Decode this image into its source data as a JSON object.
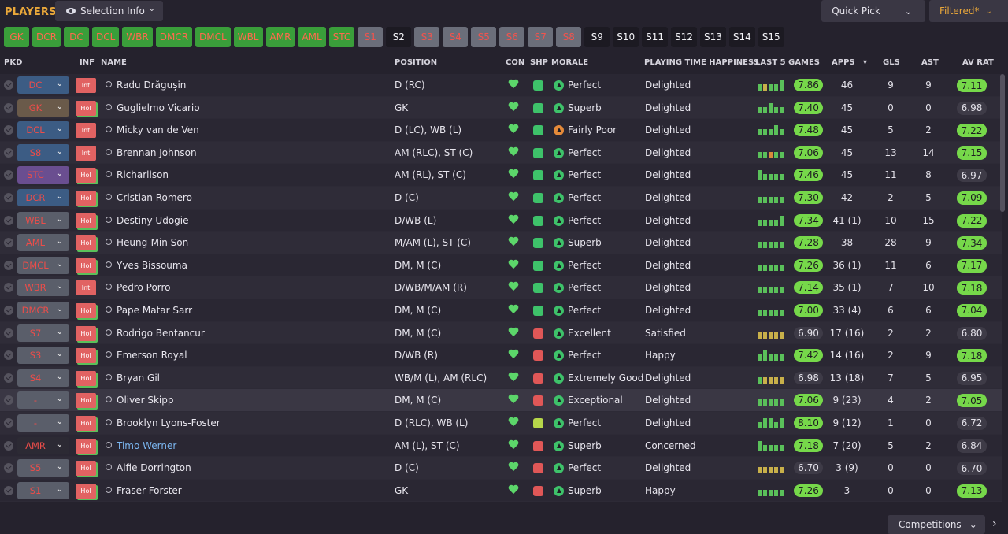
{
  "header": {
    "title": "PLAYERS",
    "selection_info": "Selection Info",
    "quick_pick": "Quick Pick",
    "filtered": "Filtered*",
    "competitions": "Competitions"
  },
  "chips": [
    {
      "label": "GK",
      "style": "green"
    },
    {
      "label": "DCR",
      "style": "green"
    },
    {
      "label": "DC",
      "style": "green"
    },
    {
      "label": "DCL",
      "style": "green"
    },
    {
      "label": "WBR",
      "style": "green"
    },
    {
      "label": "DMCR",
      "style": "green"
    },
    {
      "label": "DMCL",
      "style": "green"
    },
    {
      "label": "WBL",
      "style": "green"
    },
    {
      "label": "AMR",
      "style": "green"
    },
    {
      "label": "AML",
      "style": "green"
    },
    {
      "label": "STC",
      "style": "green"
    },
    {
      "label": "S1",
      "style": "grey"
    },
    {
      "label": "S2",
      "style": "black"
    },
    {
      "label": "S3",
      "style": "grey"
    },
    {
      "label": "S4",
      "style": "grey"
    },
    {
      "label": "S5",
      "style": "grey"
    },
    {
      "label": "S6",
      "style": "grey"
    },
    {
      "label": "S7",
      "style": "grey"
    },
    {
      "label": "S8",
      "style": "grey"
    },
    {
      "label": "S9",
      "style": "black"
    },
    {
      "label": "S10",
      "style": "black"
    },
    {
      "label": "S11",
      "style": "black"
    },
    {
      "label": "S12",
      "style": "black"
    },
    {
      "label": "S13",
      "style": "black"
    },
    {
      "label": "S14",
      "style": "black"
    },
    {
      "label": "S15",
      "style": "black"
    }
  ],
  "columns": {
    "pkd": "PKD",
    "inf": "INF",
    "name": "NAME",
    "position": "POSITION",
    "con": "CON",
    "shp": "SHP",
    "morale": "MORALE",
    "pth": "PLAYING TIME HAPPINESS",
    "last5": "LAST 5 GAMES",
    "apps": "APPS",
    "gls": "GLS",
    "ast": "AST",
    "avrat": "AV RAT"
  },
  "colors": {
    "accent": "#e9a73a",
    "tag_blue": "#3c5c84",
    "tag_brown": "#6a5a4a",
    "tag_purple": "#6a4e90",
    "tag_grey": "#5a5e6a",
    "tag_dark": "#2c2a34",
    "morale_green": "#3ec26a",
    "morale_orange": "#e58a3a",
    "rating_green": "#76d84a"
  },
  "players": [
    {
      "pos": "DC",
      "tag": "tag_blue",
      "inf": "Int",
      "name": "Radu Drăgușin",
      "position": "D (RC)",
      "ship": "good",
      "morale": "Perfect",
      "morale_color": "morale_green",
      "pth": "Delighted",
      "form": [
        "g",
        "y",
        "g",
        "g",
        "t"
      ],
      "l5": "7.86",
      "l5hi": true,
      "apps": "46",
      "gls": "9",
      "ast": "9",
      "avr": "7.11",
      "avrhi": true
    },
    {
      "pos": "GK",
      "tag": "tag_brown",
      "inf": "Hol",
      "name": "Guglielmo Vicario",
      "position": "GK",
      "ship": "good",
      "morale": "Superb",
      "morale_color": "morale_green",
      "pth": "Delighted",
      "form": [
        "g",
        "g",
        "t",
        "g",
        "g"
      ],
      "l5": "7.40",
      "l5hi": true,
      "apps": "45",
      "gls": "0",
      "ast": "0",
      "avr": "6.98",
      "avrhi": false
    },
    {
      "pos": "DCL",
      "tag": "tag_blue",
      "inf": "Int",
      "name": "Micky van de Ven",
      "position": "D (LC), WB (L)",
      "ship": "good",
      "morale": "Fairly Poor",
      "morale_color": "morale_orange",
      "pth": "Delighted",
      "form": [
        "g",
        "g",
        "g",
        "t",
        "g"
      ],
      "l5": "7.48",
      "l5hi": true,
      "apps": "45",
      "gls": "5",
      "ast": "2",
      "avr": "7.22",
      "avrhi": true
    },
    {
      "pos": "S8",
      "tag": "tag_blue",
      "inf": "Int",
      "name": "Brennan Johnson",
      "position": "AM (RLC), ST (C)",
      "ship": "good",
      "morale": "Perfect",
      "morale_color": "morale_green",
      "pth": "Delighted",
      "form": [
        "g",
        "g",
        "o",
        "g",
        "g"
      ],
      "l5": "7.06",
      "l5hi": true,
      "apps": "45",
      "gls": "13",
      "ast": "14",
      "avr": "7.15",
      "avrhi": true
    },
    {
      "pos": "STC",
      "tag": "tag_purple",
      "inf": "Hol",
      "name": "Richarlison",
      "position": "AM (RL), ST (C)",
      "ship": "good",
      "morale": "Perfect",
      "morale_color": "morale_green",
      "pth": "Delighted",
      "form": [
        "t",
        "g",
        "g",
        "g",
        "g"
      ],
      "l5": "7.46",
      "l5hi": true,
      "apps": "45",
      "gls": "11",
      "ast": "8",
      "avr": "6.97",
      "avrhi": false
    },
    {
      "pos": "DCR",
      "tag": "tag_blue",
      "inf": "Hol",
      "name": "Cristian Romero",
      "position": "D (C)",
      "ship": "good",
      "morale": "Perfect",
      "morale_color": "morale_green",
      "pth": "Delighted",
      "form": [
        "g",
        "g",
        "g",
        "g",
        "g"
      ],
      "l5": "7.30",
      "l5hi": true,
      "apps": "42",
      "gls": "2",
      "ast": "5",
      "avr": "7.09",
      "avrhi": true
    },
    {
      "pos": "WBL",
      "tag": "tag_grey",
      "inf": "Hol",
      "name": "Destiny Udogie",
      "position": "D/WB (L)",
      "ship": "good",
      "morale": "Perfect",
      "morale_color": "morale_green",
      "pth": "Delighted",
      "form": [
        "g",
        "g",
        "g",
        "g",
        "t"
      ],
      "l5": "7.34",
      "l5hi": true,
      "apps": "41 (1)",
      "gls": "10",
      "ast": "15",
      "avr": "7.22",
      "avrhi": true
    },
    {
      "pos": "AML",
      "tag": "tag_grey",
      "inf": "Hol",
      "name": "Heung-Min Son",
      "position": "M/AM (L), ST (C)",
      "ship": "good",
      "morale": "Superb",
      "morale_color": "morale_green",
      "pth": "Delighted",
      "form": [
        "g",
        "g",
        "g",
        "g",
        "g"
      ],
      "l5": "7.28",
      "l5hi": true,
      "apps": "38",
      "gls": "28",
      "ast": "9",
      "avr": "7.34",
      "avrhi": true
    },
    {
      "pos": "DMCL",
      "tag": "tag_grey",
      "inf": "Hol",
      "name": "Yves Bissouma",
      "position": "DM, M (C)",
      "ship": "good",
      "morale": "Perfect",
      "morale_color": "morale_green",
      "pth": "Delighted",
      "form": [
        "g",
        "g",
        "g",
        "g",
        "g"
      ],
      "l5": "7.26",
      "l5hi": true,
      "apps": "36 (1)",
      "gls": "11",
      "ast": "6",
      "avr": "7.17",
      "avrhi": true
    },
    {
      "pos": "WBR",
      "tag": "tag_grey",
      "inf": "Int",
      "name": "Pedro Porro",
      "position": "D/WB/M/AM (R)",
      "ship": "good",
      "morale": "Perfect",
      "morale_color": "morale_green",
      "pth": "Delighted",
      "form": [
        "g",
        "g",
        "g",
        "g",
        "g"
      ],
      "l5": "7.14",
      "l5hi": true,
      "apps": "35 (1)",
      "gls": "7",
      "ast": "10",
      "avr": "7.18",
      "avrhi": true
    },
    {
      "pos": "DMCR",
      "tag": "tag_grey",
      "inf": "Hol",
      "name": "Pape Matar Sarr",
      "position": "DM, M (C)",
      "ship": "good",
      "morale": "Perfect",
      "morale_color": "morale_green",
      "pth": "Delighted",
      "form": [
        "g",
        "g",
        "g",
        "g",
        "g"
      ],
      "l5": "7.00",
      "l5hi": true,
      "apps": "33 (4)",
      "gls": "6",
      "ast": "6",
      "avr": "7.04",
      "avrhi": true
    },
    {
      "pos": "S7",
      "tag": "tag_grey",
      "inf": "Hol",
      "name": "Rodrigo Bentancur",
      "position": "DM, M (C)",
      "ship": "bad",
      "morale": "Excellent",
      "morale_color": "morale_green",
      "pth": "Satisfied",
      "form": [
        "y",
        "y",
        "y",
        "y",
        "y"
      ],
      "l5": "6.90",
      "l5hi": false,
      "apps": "17 (16)",
      "gls": "2",
      "ast": "2",
      "avr": "6.80",
      "avrhi": false
    },
    {
      "pos": "S3",
      "tag": "tag_grey",
      "inf": "Hol",
      "name": "Emerson Royal",
      "position": "D/WB (R)",
      "ship": "bad",
      "morale": "Perfect",
      "morale_color": "morale_green",
      "pth": "Happy",
      "form": [
        "g",
        "t",
        "g",
        "g",
        "g"
      ],
      "l5": "7.42",
      "l5hi": true,
      "apps": "14 (16)",
      "gls": "2",
      "ast": "9",
      "avr": "7.18",
      "avrhi": true
    },
    {
      "pos": "S4",
      "tag": "tag_grey",
      "inf": "Hol",
      "name": "Bryan Gil",
      "position": "WB/M (L), AM (RLC)",
      "ship": "bad",
      "morale": "Extremely Good",
      "morale_color": "morale_green",
      "pth": "Delighted",
      "form": [
        "g",
        "y",
        "y",
        "y",
        "y"
      ],
      "l5": "6.98",
      "l5hi": false,
      "apps": "13 (18)",
      "gls": "7",
      "ast": "5",
      "avr": "6.95",
      "avrhi": false
    },
    {
      "pos": "-",
      "tag": "tag_grey",
      "inf": "Hol",
      "name": "Oliver Skipp",
      "position": "DM, M (C)",
      "ship": "bad",
      "morale": "Exceptional",
      "morale_color": "morale_green",
      "pth": "Delighted",
      "form": [
        "g",
        "g",
        "g",
        "g",
        "g"
      ],
      "l5": "7.06",
      "l5hi": true,
      "apps": "9 (23)",
      "gls": "4",
      "ast": "2",
      "avr": "7.05",
      "avrhi": true,
      "hl": true
    },
    {
      "pos": "-",
      "tag": "tag_grey",
      "inf": "Hol",
      "name": "Brooklyn Lyons-Foster",
      "position": "D (RLC), WB (L)",
      "ship": "mid",
      "morale": "Perfect",
      "morale_color": "morale_green",
      "pth": "Delighted",
      "form": [
        "g",
        "t",
        "t",
        "g",
        "t"
      ],
      "l5": "8.10",
      "l5hi": true,
      "apps": "9 (12)",
      "gls": "1",
      "ast": "0",
      "avr": "6.72",
      "avrhi": false
    },
    {
      "pos": "AMR",
      "tag": "tag_dark",
      "inf": "Hol",
      "name": "Timo Werner",
      "position": "AM (L), ST (C)",
      "ship": "bad",
      "morale": "Superb",
      "morale_color": "morale_green",
      "pth": "Concerned",
      "form": [
        "t",
        "g",
        "g",
        "g",
        "g"
      ],
      "l5": "7.18",
      "l5hi": true,
      "apps": "7 (20)",
      "gls": "5",
      "ast": "2",
      "avr": "6.84",
      "avrhi": false,
      "link": true
    },
    {
      "pos": "S5",
      "tag": "tag_grey",
      "inf": "Hol",
      "name": "Alfie Dorrington",
      "position": "D (C)",
      "ship": "bad",
      "morale": "Perfect",
      "morale_color": "morale_green",
      "pth": "Delighted",
      "form": [
        "y",
        "y",
        "y",
        "y",
        "y"
      ],
      "l5": "6.70",
      "l5hi": false,
      "apps": "3 (9)",
      "gls": "0",
      "ast": "0",
      "avr": "6.70",
      "avrhi": false
    },
    {
      "pos": "S1",
      "tag": "tag_grey",
      "inf": "Hol",
      "name": "Fraser Forster",
      "position": "GK",
      "ship": "bad",
      "morale": "Superb",
      "morale_color": "morale_green",
      "pth": "Happy",
      "form": [
        "g",
        "g",
        "g",
        "g",
        "g"
      ],
      "l5": "7.26",
      "l5hi": true,
      "apps": "3",
      "gls": "0",
      "ast": "0",
      "avr": "7.13",
      "avrhi": true
    }
  ]
}
